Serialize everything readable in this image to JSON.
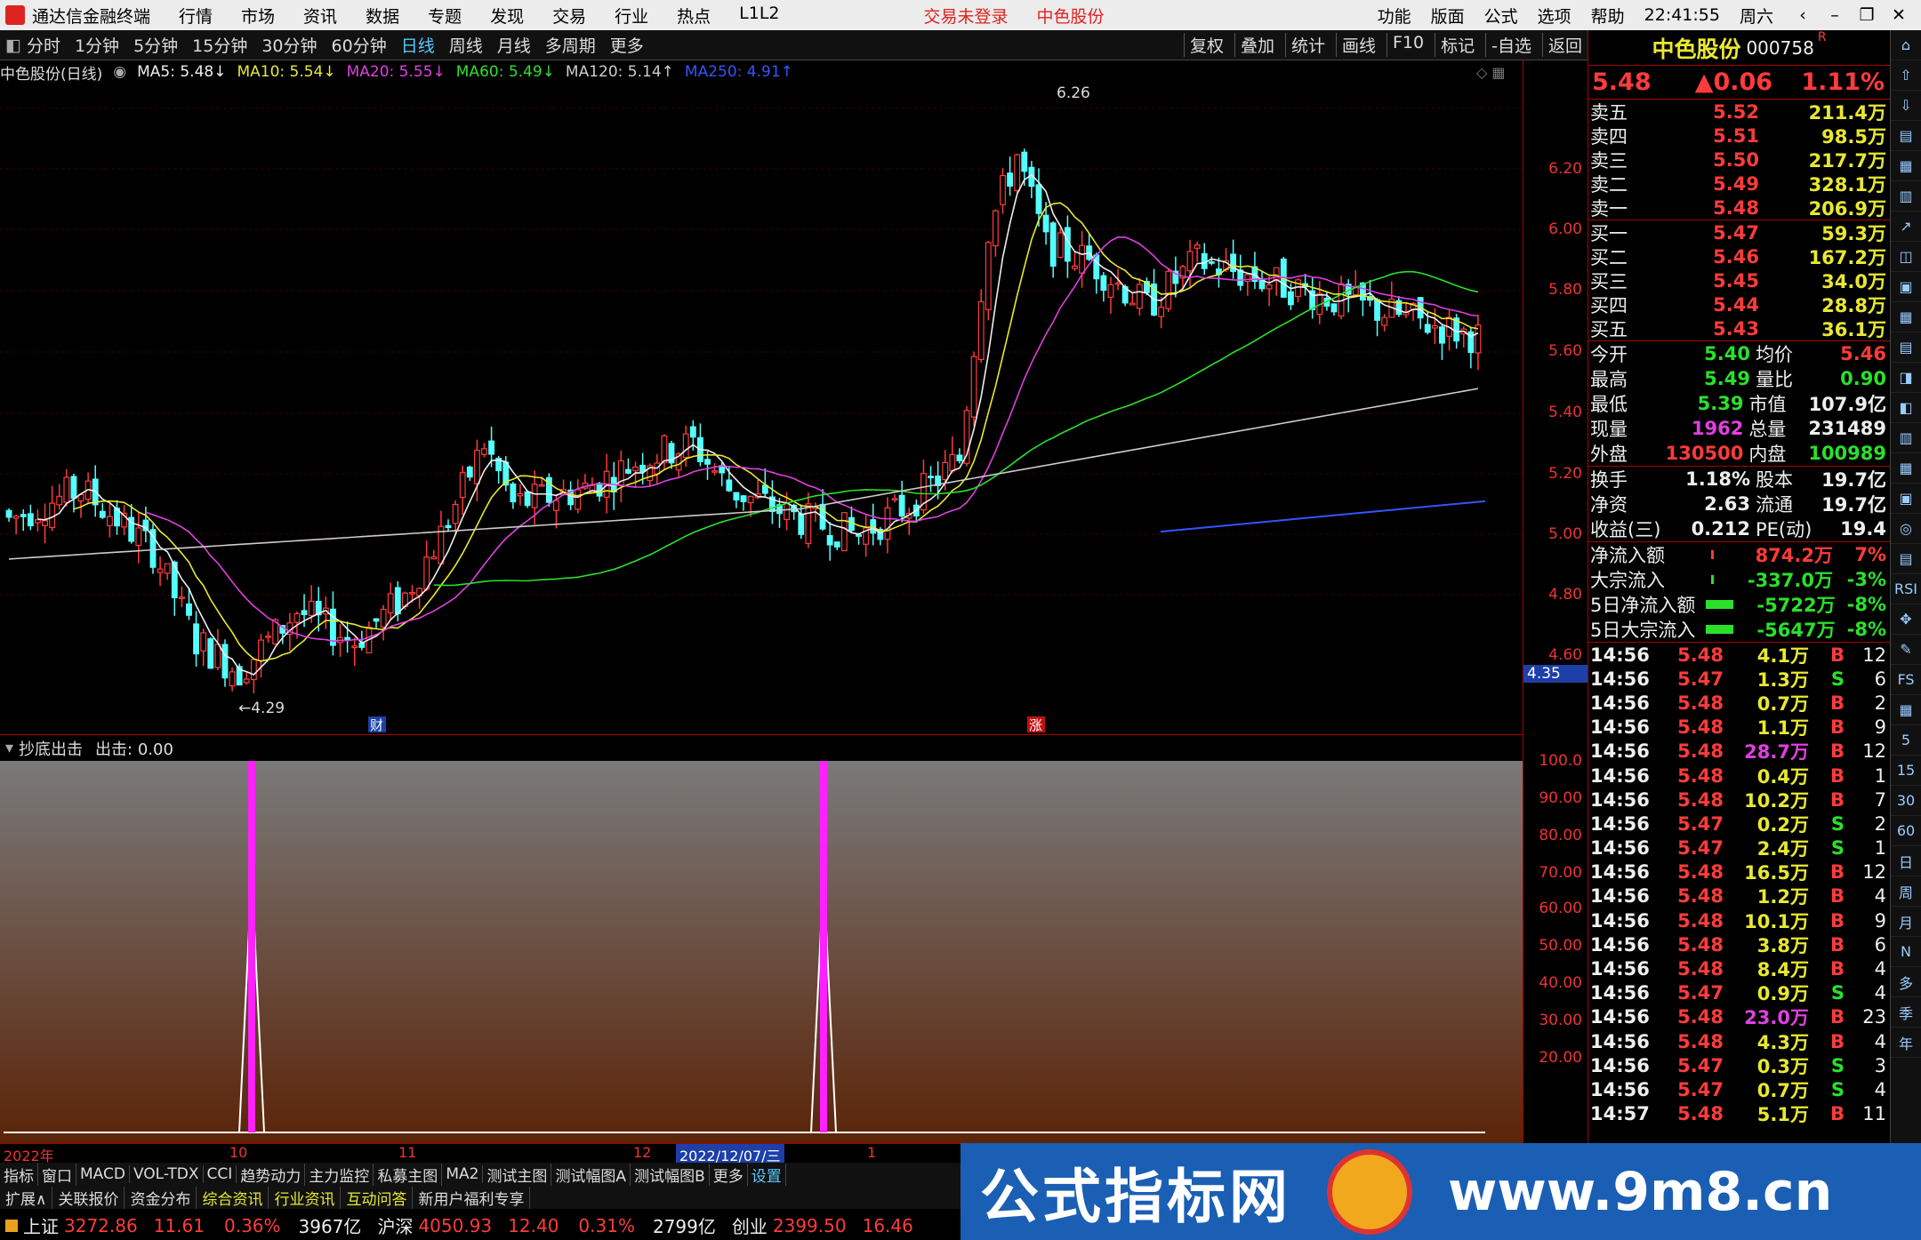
{
  "app": {
    "title": "通达信金融终端",
    "menus": [
      "行情",
      "市场",
      "资讯",
      "数据",
      "专题",
      "发现",
      "交易",
      "行业",
      "热点",
      "L1L2"
    ],
    "login": "交易未登录",
    "stock_menu": "中色股份",
    "right_menus": [
      "功能",
      "版面",
      "公式",
      "选项",
      "帮助"
    ],
    "clock": "22:41:55",
    "weekday": "周六"
  },
  "periods": [
    "分时",
    "1分钟",
    "5分钟",
    "15分钟",
    "30分钟",
    "60分钟",
    "日线",
    "周线",
    "月线",
    "多周期",
    "更多"
  ],
  "active_period": "日线",
  "toolbar_right": [
    "复权",
    "叠加",
    "统计",
    "画线",
    "F10",
    "标记",
    "-自选",
    "返回"
  ],
  "ma_bar": {
    "name": "中色股份(日线)",
    "items": [
      {
        "t": "MA5: 5.48↓",
        "c": "#eeeeee"
      },
      {
        "t": "MA10: 5.54↓",
        "c": "#e8e830"
      },
      {
        "t": "MA20: 5.55↓",
        "c": "#e040e0"
      },
      {
        "t": "MA60: 5.49↓",
        "c": "#2be02b"
      },
      {
        "t": "MA120: 5.14↑",
        "c": "#cccccc"
      },
      {
        "t": "MA250: 4.91↑",
        "c": "#3355ff"
      }
    ]
  },
  "price_axis": [
    "6.20",
    "6.00",
    "5.80",
    "5.60",
    "5.40",
    "5.20",
    "5.00",
    "4.80",
    "4.60"
  ],
  "price_marker": "4.35",
  "chart_labels": {
    "high": "6.26",
    "low": "←4.29",
    "cai": "财",
    "zhang": "涨"
  },
  "indicator": {
    "name": "抄底出击",
    "value_label": "出击: 0.00",
    "axis": [
      "100.0",
      "90.00",
      "80.00",
      "70.00",
      "60.00",
      "50.00",
      "40.00",
      "30.00",
      "20.00"
    ]
  },
  "dates": {
    "year": "2022年",
    "m10": "10",
    "m11": "11",
    "m12": "12",
    "sel": "2022/12/07/三",
    "m1": "1"
  },
  "bottom_tabs1": [
    "指标",
    "窗口",
    "MACD",
    "VOL-TDX",
    "CCI",
    "趋势动力",
    "主力监控",
    "私募主图",
    "MA2",
    "测试主图",
    "测试幅图A",
    "测试幅图B",
    "更多",
    "设置"
  ],
  "bottom_tabs2": [
    "扩展∧",
    "关联报价",
    "资金分布",
    "综合资讯",
    "行业资讯",
    "互动问答",
    "新用户福利专享"
  ],
  "status": {
    "sh": "上证",
    "sh_v": "3272.86",
    "sh_c": "11.61",
    "sh_p": "0.36%",
    "sh_a": "3967亿",
    "hs": "沪深",
    "hs_v": "4050.93",
    "hs_c": "12.40",
    "hs_p": "0.31%",
    "hs_a": "2799亿",
    "cy": "创业",
    "cy_v": "2399.50",
    "cy_c": "16.46"
  },
  "banner": {
    "text": "公式指标网",
    "url": "www.9m8.cn"
  },
  "quote": {
    "name": "中色股份",
    "code": "000758",
    "flag": "R",
    "price": "5.48",
    "change": "▲0.06",
    "pct": "1.11%"
  },
  "asks": [
    [
      "卖五",
      "5.52",
      "211.4万"
    ],
    [
      "卖四",
      "5.51",
      "98.5万"
    ],
    [
      "卖三",
      "5.50",
      "217.7万"
    ],
    [
      "卖二",
      "5.49",
      "328.1万"
    ],
    [
      "卖一",
      "5.48",
      "206.9万"
    ]
  ],
  "bids": [
    [
      "买一",
      "5.47",
      "59.3万"
    ],
    [
      "买二",
      "5.46",
      "167.2万"
    ],
    [
      "买三",
      "5.45",
      "34.0万"
    ],
    [
      "买四",
      "5.44",
      "28.8万"
    ],
    [
      "买五",
      "5.43",
      "36.1万"
    ]
  ],
  "stats": [
    [
      "今开",
      "5.40",
      "均价",
      "5.46"
    ],
    [
      "最高",
      "5.49",
      "量比",
      "0.90"
    ],
    [
      "最低",
      "5.39",
      "市值",
      "107.9亿"
    ],
    [
      "现量",
      "1962",
      "总量",
      "231489"
    ],
    [
      "外盘",
      "130500",
      "内盘",
      "100989"
    ]
  ],
  "stats2": [
    [
      "换手",
      "1.18%",
      "股本",
      "19.7亿"
    ],
    [
      "净资",
      "2.63",
      "流通",
      "19.7亿"
    ],
    [
      "收益(三)",
      "0.212",
      "PE(动)",
      "19.4"
    ]
  ],
  "flows": [
    [
      "净流入额",
      "874.2万",
      "7%"
    ],
    [
      "大宗流入",
      "-337.0万",
      "-3%"
    ],
    [
      "5日净流入额",
      "-5722万",
      "-8%"
    ],
    [
      "5日大宗流入",
      "-5647万",
      "-8%"
    ]
  ],
  "ticks": [
    [
      "14:56",
      "5.48",
      "4.1万",
      "B",
      "12"
    ],
    [
      "14:56",
      "5.47",
      "1.3万",
      "S",
      "6"
    ],
    [
      "14:56",
      "5.48",
      "0.7万",
      "B",
      "2"
    ],
    [
      "14:56",
      "5.48",
      "1.1万",
      "B",
      "9"
    ],
    [
      "14:56",
      "5.48",
      "28.7万",
      "B",
      "12"
    ],
    [
      "14:56",
      "5.48",
      "0.4万",
      "B",
      "1"
    ],
    [
      "14:56",
      "5.48",
      "10.2万",
      "B",
      "7"
    ],
    [
      "14:56",
      "5.47",
      "0.2万",
      "S",
      "2"
    ],
    [
      "14:56",
      "5.47",
      "2.4万",
      "S",
      "1"
    ],
    [
      "14:56",
      "5.48",
      "16.5万",
      "B",
      "12"
    ],
    [
      "14:56",
      "5.48",
      "1.2万",
      "B",
      "4"
    ],
    [
      "14:56",
      "5.48",
      "10.1万",
      "B",
      "9"
    ],
    [
      "14:56",
      "5.48",
      "3.8万",
      "B",
      "6"
    ],
    [
      "14:56",
      "5.48",
      "8.4万",
      "B",
      "4"
    ],
    [
      "14:56",
      "5.47",
      "0.9万",
      "S",
      "4"
    ],
    [
      "14:56",
      "5.48",
      "23.0万",
      "B",
      "23"
    ],
    [
      "14:56",
      "5.48",
      "4.3万",
      "B",
      "4"
    ],
    [
      "14:56",
      "5.47",
      "0.3万",
      "S",
      "3"
    ],
    [
      "14:56",
      "5.47",
      "0.7万",
      "S",
      "4"
    ],
    [
      "14:57",
      "5.48",
      "5.1万",
      "B",
      "11"
    ]
  ],
  "side_icons": [
    "日",
    "周",
    "月",
    "N",
    "多",
    "季",
    "年"
  ]
}
